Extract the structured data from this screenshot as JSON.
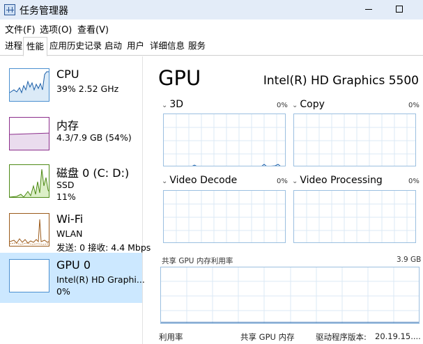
{
  "window": {
    "title": "任务管理器",
    "icon": "task-manager-icon"
  },
  "menu": {
    "file": "文件(F)",
    "options": "选项(O)",
    "view": "查看(V)"
  },
  "tabs": [
    "进程",
    "性能",
    "应用历史记录",
    "启动",
    "用户",
    "详细信息",
    "服务"
  ],
  "active_tab": "性能",
  "sidebar": {
    "cpu": {
      "title": "CPU",
      "line1": "39% 2.52 GHz"
    },
    "memory": {
      "title": "内存",
      "line1": "4.3/7.9 GB (54%)"
    },
    "disk": {
      "title": "磁盘 0 (C: D:)",
      "line1": "SSD",
      "line2": "11%"
    },
    "wifi": {
      "title": "Wi-Fi",
      "line1": "WLAN",
      "line2": "发送: 0 接收: 4.4 Mbps"
    },
    "gpu": {
      "title": "GPU 0",
      "line1": "Intel(R) HD Graphi...",
      "line2": "0%"
    }
  },
  "main": {
    "title": "GPU",
    "model": "Intel(R) HD Graphics 5500",
    "engines": [
      {
        "label": "3D",
        "percent": "0%"
      },
      {
        "label": "Copy",
        "percent": "0%"
      },
      {
        "label": "Video Decode",
        "percent": "0%"
      },
      {
        "label": "Video Processing",
        "percent": "0%"
      }
    ],
    "shared_memory_label": "共享 GPU 内存利用率",
    "shared_memory_value": "3.9 GB",
    "bottom": {
      "utilization": "利用率",
      "shared_memory": "共享 GPU 内存",
      "driver_label": "驱动程序版本:",
      "driver_version": "20.19.15...."
    }
  },
  "colors": {
    "titlebar": "#e3ecf8",
    "selected": "#cce8ff",
    "cpu_line": "#1a5ea8",
    "memory_line": "#8b2d8b",
    "disk_line": "#4d8a15",
    "wifi_line": "#9b5a1a",
    "gpu_line": "#1a5ea8"
  }
}
